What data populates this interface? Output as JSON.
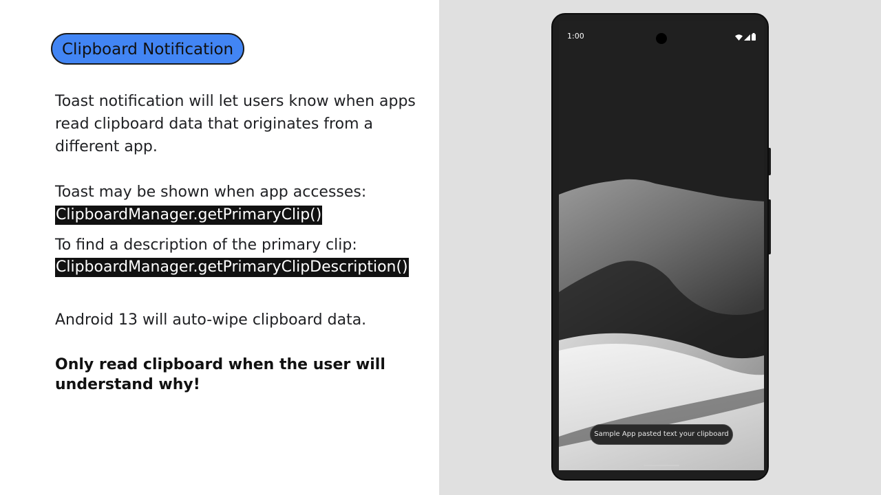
{
  "slide": {
    "title": "Clipboard Notification",
    "paragraph1": "Toast notification will let users know when apps read clipboard data that originates from a different app.",
    "paragraph2": "Toast may be shown when app accesses:",
    "code1": "ClipboardManager.getPrimaryClip()",
    "paragraph3": "To find a description of the primary clip:",
    "code2": "ClipboardManager.getPrimaryClipDescription()",
    "paragraph4": "Android 13 will auto-wipe clipboard data.",
    "emphasis": "Only read clipboard when the user will understand why!"
  },
  "phone": {
    "status_time": "1:00",
    "status_icons": [
      "wifi-icon",
      "cellular-signal-icon",
      "battery-icon"
    ],
    "toast_text": "Sample App pasted text your clipboard"
  },
  "colors": {
    "title_pill": "#4285f4",
    "right_panel": "#e0e0e0",
    "code_background": "#111111"
  }
}
